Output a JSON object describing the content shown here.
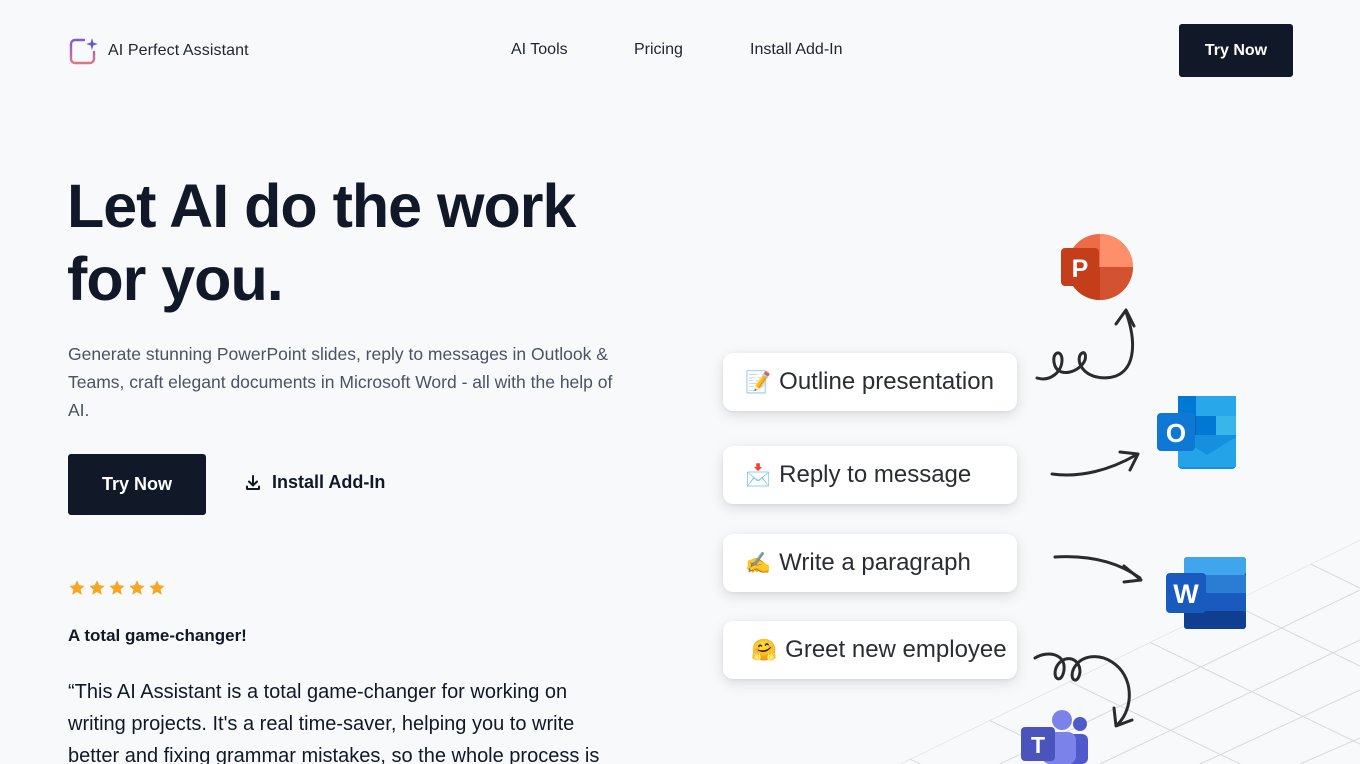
{
  "header": {
    "brand": "AI Perfect Assistant",
    "nav": [
      {
        "label": "AI Tools"
      },
      {
        "label": "Pricing"
      },
      {
        "label": "Install Add-In"
      }
    ],
    "cta_label": "Try Now"
  },
  "hero": {
    "title_line1": "Let AI do the work",
    "title_line2": "for you.",
    "subtitle": "Generate stunning PowerPoint slides, reply to messages in Outlook & Teams, craft elegant documents in Microsoft Word - all with the help of AI.",
    "cta_label": "Try Now",
    "install_label": "Install Add-In"
  },
  "review": {
    "rating": 5,
    "rating_max": 5,
    "title": "A total game-changer!",
    "text": "“This AI Assistant is a total game-changer for working on writing projects. It's a real time-saver, helping you to write better and fixing grammar mistakes, so the whole process is"
  },
  "prompts": [
    {
      "emoji": "📝",
      "label": "Outline presentation",
      "target": "PowerPoint"
    },
    {
      "emoji": "📩",
      "label": "Reply to message",
      "target": "Outlook"
    },
    {
      "emoji": "✍️",
      "label": "Write a paragraph",
      "target": "Word"
    },
    {
      "emoji": "🤗",
      "label": "Greet new employee",
      "target": "Teams"
    }
  ],
  "apps": {
    "powerpoint_letter": "P",
    "outlook_letter": "O",
    "word_letter": "W",
    "teams_letter": "T"
  },
  "colors": {
    "primary": "#111827",
    "star": "#f5a623",
    "background": "#f8f9fb"
  }
}
